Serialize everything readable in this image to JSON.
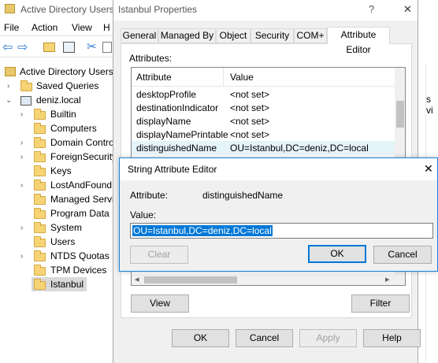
{
  "mmc": {
    "title": "Active Directory Users",
    "menu": [
      "File",
      "Action",
      "View",
      "H"
    ],
    "tree_root": "Active Directory Users",
    "saved_queries": "Saved Queries",
    "domain": "deniz.local",
    "items": [
      "Builtin",
      "Computers",
      "Domain Contro",
      "ForeignSecurity",
      "Keys",
      "LostAndFound",
      "Managed Servi",
      "Program Data",
      "System",
      "Users",
      "NTDS Quotas",
      "TPM Devices",
      "Istanbul"
    ],
    "right_fragment": "s vi"
  },
  "props": {
    "title": "Istanbul Properties",
    "help": "?",
    "close": "✕",
    "tabs": [
      "General",
      "Managed By",
      "Object",
      "Security",
      "COM+",
      "Attribute Editor"
    ],
    "attributes_label": "Attributes:",
    "col_attribute": "Attribute",
    "col_value": "Value",
    "rows": [
      {
        "attr": "desktopProfile",
        "val": "<not set>"
      },
      {
        "attr": "destinationIndicator",
        "val": "<not set>"
      },
      {
        "attr": "displayName",
        "val": "<not set>"
      },
      {
        "attr": "displayNamePrintable",
        "val": "<not set>"
      },
      {
        "attr": "distinguishedName",
        "val": "OU=Istanbul,DC=deniz,DC=local"
      }
    ],
    "view_btn": "View",
    "filter_btn": "Filter",
    "ok": "OK",
    "cancel": "Cancel",
    "apply": "Apply",
    "help_btn": "Help"
  },
  "editor": {
    "title": "String Attribute Editor",
    "close": "✕",
    "attribute_label": "Attribute:",
    "attribute_value": "distinguishedName",
    "value_label": "Value:",
    "value": "OU=Istanbul,DC=deniz,DC=local",
    "clear": "Clear",
    "ok": "OK",
    "cancel": "Cancel"
  }
}
